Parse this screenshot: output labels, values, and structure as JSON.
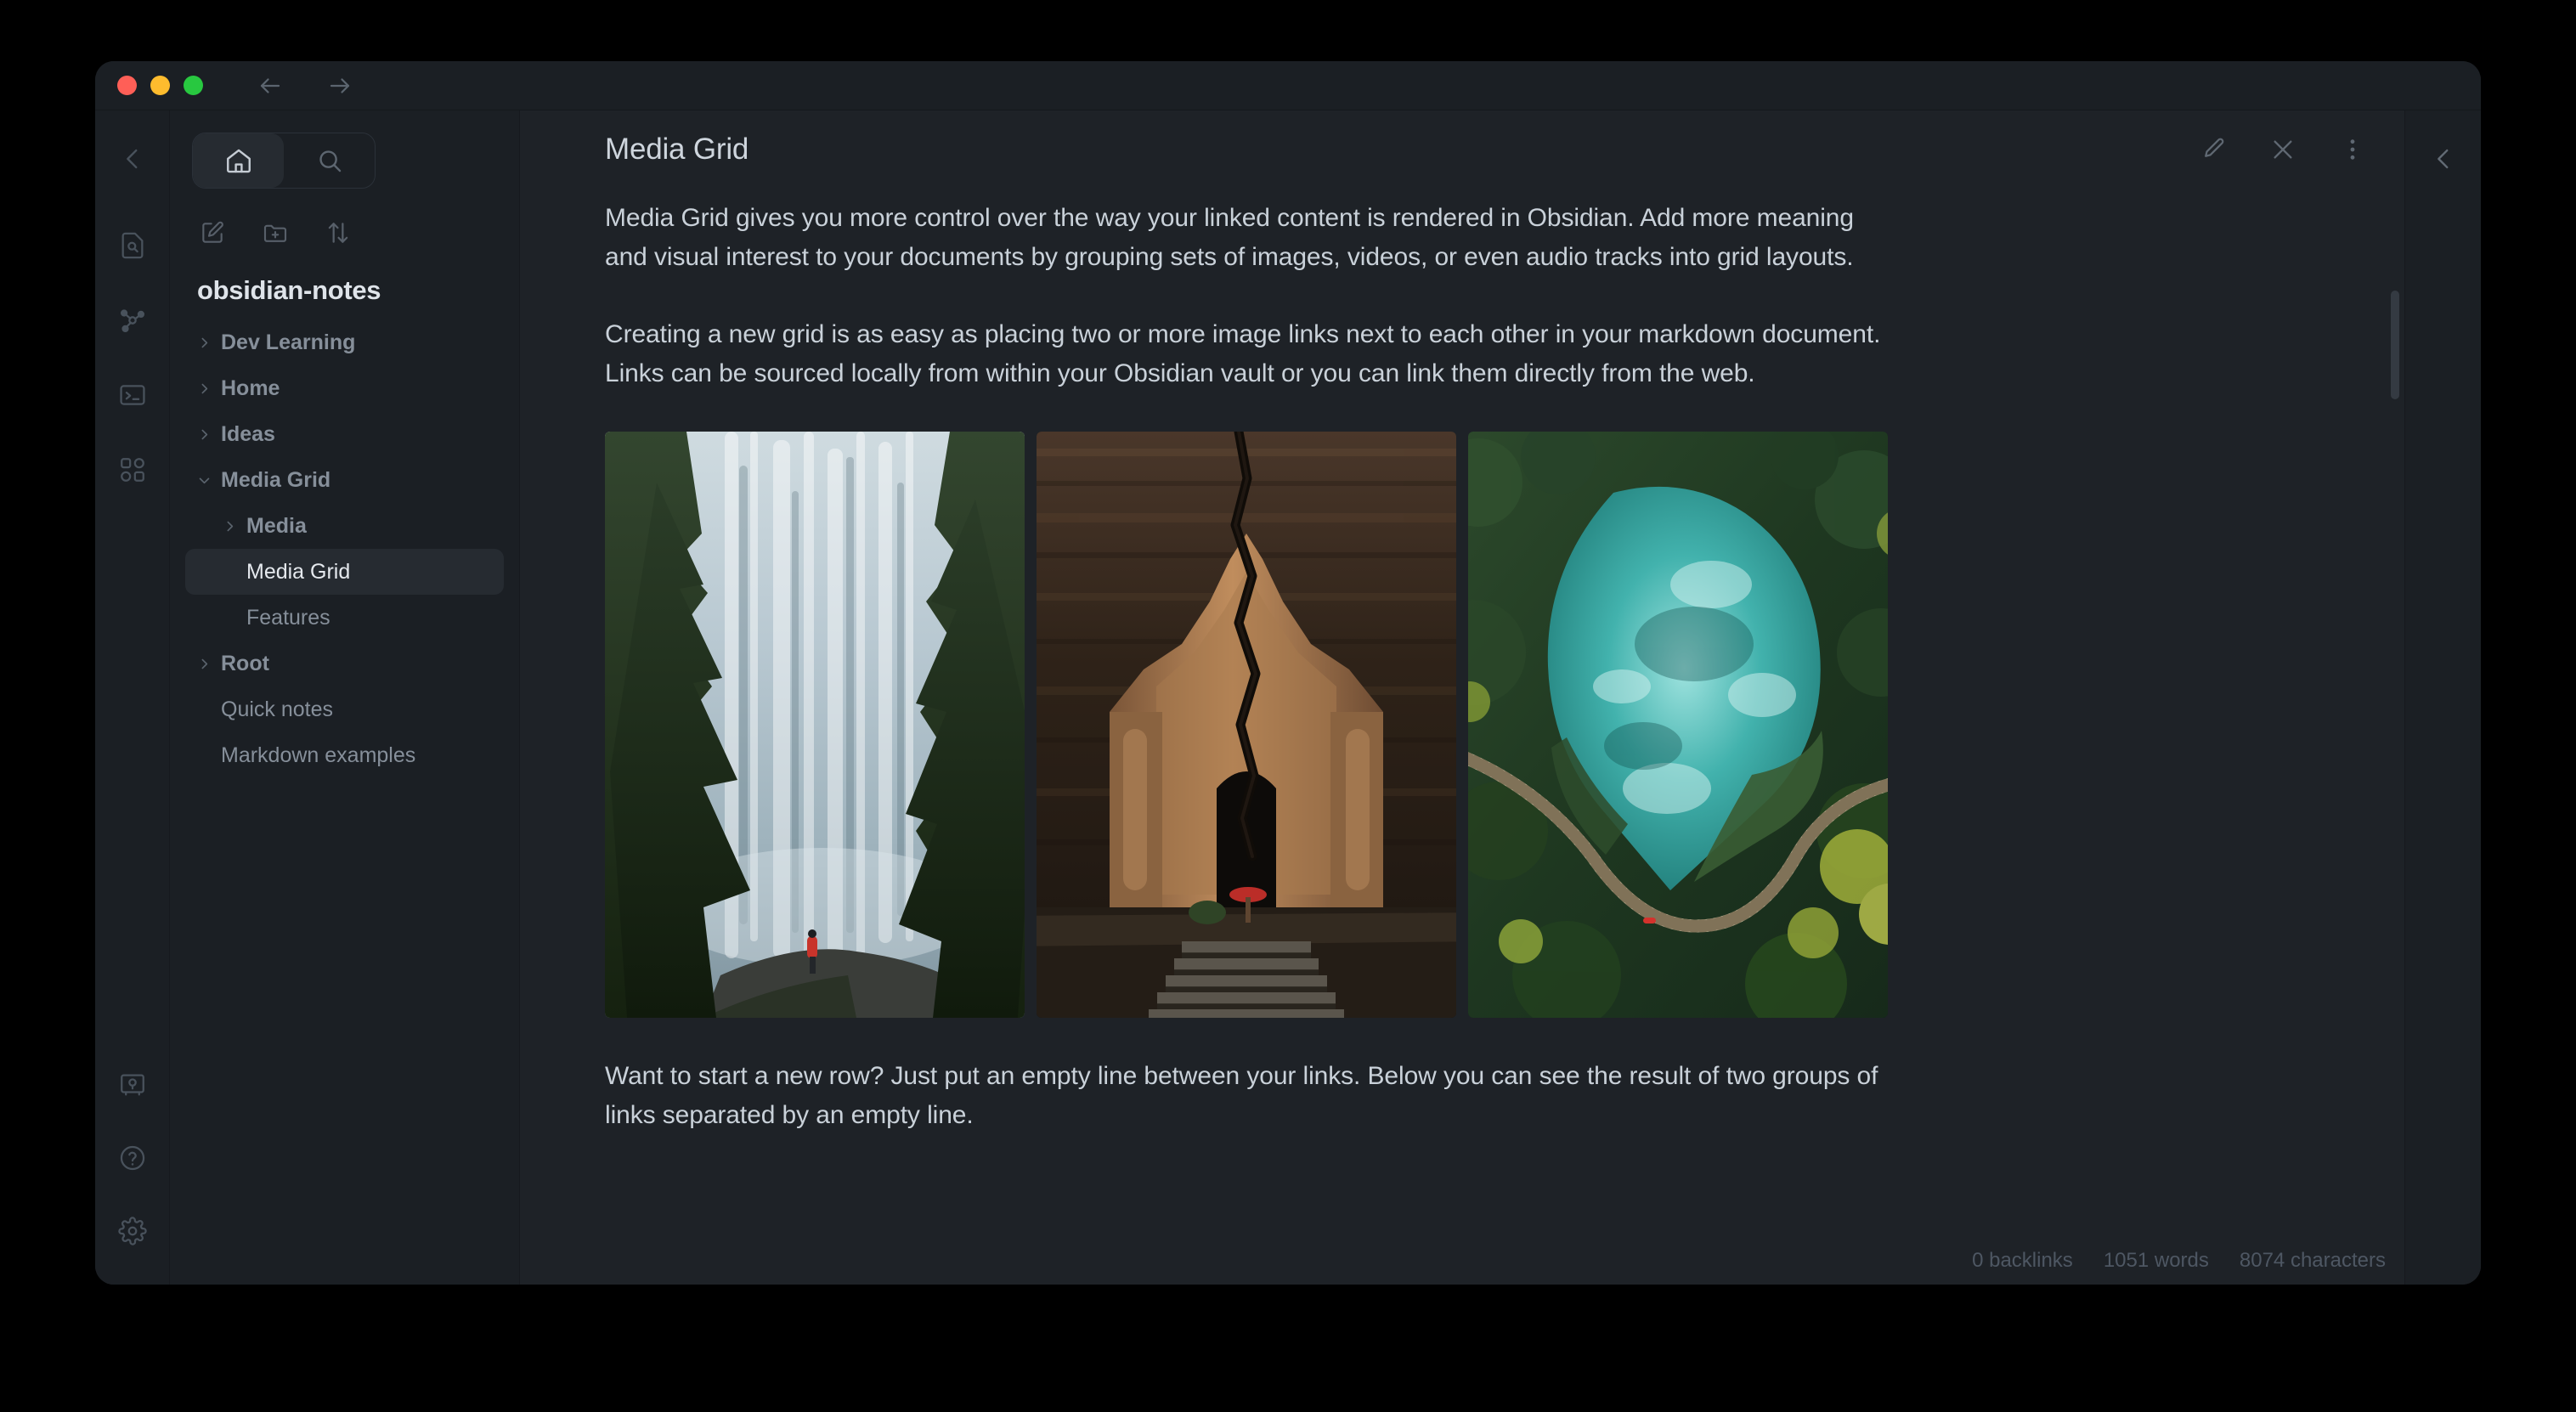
{
  "window": {
    "traffic_lights": [
      "close",
      "minimize",
      "maximize"
    ],
    "nav_back": "back-arrow",
    "nav_forward": "forward-arrow"
  },
  "icon_rail": {
    "collapse_label": "collapse-sidebar",
    "items": [
      {
        "name": "file-search-icon",
        "label": "Search in file"
      },
      {
        "name": "graph-icon",
        "label": "Graph view"
      },
      {
        "name": "terminal-icon",
        "label": "Terminal"
      },
      {
        "name": "apps-grid-icon",
        "label": "Plugins"
      }
    ],
    "bottom_items": [
      {
        "name": "vault-icon",
        "label": "Open another vault"
      },
      {
        "name": "help-icon",
        "label": "Help"
      },
      {
        "name": "settings-icon",
        "label": "Settings"
      }
    ]
  },
  "explorer": {
    "toggle": [
      {
        "name": "home-icon",
        "label": "Home",
        "active": true
      },
      {
        "name": "search-icon",
        "label": "Search",
        "active": false
      }
    ],
    "tools": [
      {
        "name": "new-note-icon",
        "label": "New note"
      },
      {
        "name": "new-folder-icon",
        "label": "New folder"
      },
      {
        "name": "sort-icon",
        "label": "Change sort order"
      }
    ],
    "vault_title": "obsidian-notes",
    "tree": [
      {
        "label": "Dev Learning",
        "type": "folder",
        "depth": 0,
        "expanded": false,
        "selected": false
      },
      {
        "label": "Home",
        "type": "folder",
        "depth": 0,
        "expanded": false,
        "selected": false
      },
      {
        "label": "Ideas",
        "type": "folder",
        "depth": 0,
        "expanded": false,
        "selected": false
      },
      {
        "label": "Media Grid",
        "type": "folder",
        "depth": 0,
        "expanded": true,
        "selected": false
      },
      {
        "label": "Media",
        "type": "folder",
        "depth": 1,
        "expanded": false,
        "selected": false
      },
      {
        "label": "Media Grid",
        "type": "file",
        "depth": 1,
        "expanded": false,
        "selected": true
      },
      {
        "label": "Features",
        "type": "file",
        "depth": 1,
        "expanded": false,
        "selected": false
      },
      {
        "label": "Root",
        "type": "folder",
        "depth": 0,
        "expanded": false,
        "selected": false
      },
      {
        "label": "Quick notes",
        "type": "file",
        "depth": 0,
        "expanded": false,
        "selected": false
      },
      {
        "label": "Markdown examples",
        "type": "file",
        "depth": 0,
        "expanded": false,
        "selected": false
      }
    ]
  },
  "document": {
    "title": "Media Grid",
    "header_actions": [
      {
        "name": "edit-pencil-icon",
        "label": "Edit"
      },
      {
        "name": "close-icon",
        "label": "Close"
      },
      {
        "name": "more-options-icon",
        "label": "More options"
      }
    ],
    "paragraphs": [
      "Media Grid gives you more control over the way your linked content is rendered in Obsidian. Add more meaning and visual interest to your documents by grouping sets of images, videos, or even audio tracks into grid layouts.",
      "Creating a new grid is as easy as placing two or more image links next to each other in your markdown document. Links can be sourced locally from within your Obsidian vault or you can link them directly from the web.",
      "Want to start a new row? Just put an empty line between your links. Below you can see the result of two groups of links separated by an empty line."
    ],
    "media": [
      {
        "name": "waterfall-forest-photo",
        "alt": "Waterfall framed by evergreen trees with a hiker in a red jacket"
      },
      {
        "name": "cracked-temple-photo",
        "alt": "Ancient cracked brick temple with a red umbrella in the doorway"
      },
      {
        "name": "aerial-lake-boardwalk-photo",
        "alt": "Aerial view of a turquoise lake in a forest with a winding boardwalk"
      }
    ]
  },
  "right_rail": {
    "collapse_label": "collapse-right-sidebar"
  },
  "status_bar": {
    "backlinks": "0 backlinks",
    "words": "1051 words",
    "characters": "8074 characters"
  }
}
